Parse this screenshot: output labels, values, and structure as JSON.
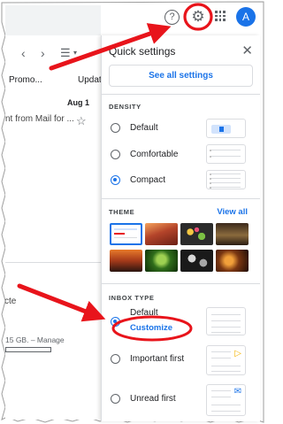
{
  "nav": {
    "prev_icon": "chevron-left-icon",
    "next_icon": "chevron-right-icon",
    "density_menu_icon": "density-menu-icon",
    "density_menu_caret": "▾"
  },
  "tabs": [
    "Promo...",
    "Updat"
  ],
  "mail": {
    "date": "Aug 1",
    "snippet": "nt from Mail for ...",
    "star_icon": "star-outline-icon"
  },
  "storage": {
    "partial_label": "cte",
    "text": "15 GB. – Manage",
    "fill_fraction": 0.02
  },
  "header": {
    "help_icon": "help-circle-icon",
    "settings_icon": "gear-icon",
    "apps_icon": "apps-grid-icon",
    "avatar_letter": "A"
  },
  "quick_settings": {
    "title": "Quick settings",
    "close_icon": "close-icon",
    "see_all_label": "See all settings",
    "density": {
      "heading": "DENSITY",
      "options": [
        {
          "label": "Default",
          "selected": false
        },
        {
          "label": "Comfortable",
          "selected": false
        },
        {
          "label": "Compact",
          "selected": true
        }
      ]
    },
    "theme": {
      "heading": "THEME",
      "view_all": "View all",
      "thumbnails": [
        "theme-default",
        "theme-canyon",
        "theme-bubbles",
        "theme-chess",
        "theme-sunset-sea",
        "theme-leaf",
        "theme-bubbles-mono",
        "theme-lanterns"
      ]
    },
    "inbox_type": {
      "heading": "INBOX TYPE",
      "customize": "Customize",
      "options": [
        {
          "label": "Default",
          "selected": true
        },
        {
          "label": "Important first",
          "selected": false
        },
        {
          "label": "Unread first",
          "selected": false
        }
      ]
    }
  },
  "colors": {
    "accent": "#1a73e8",
    "annotation_red": "#e8141b",
    "important_marker": "#f4b400"
  }
}
